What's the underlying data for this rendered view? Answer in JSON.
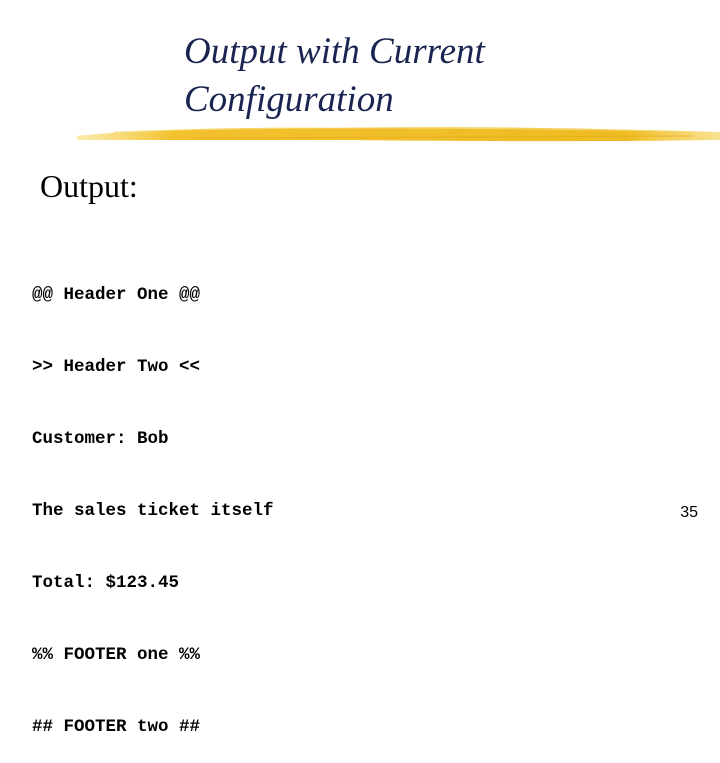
{
  "slide": {
    "title_lines": [
      "Output with Current",
      "Configuration"
    ],
    "section_label": "Output:",
    "output_lines": [
      "@@ Header One @@",
      ">> Header Two <<",
      "Customer: Bob",
      "The sales ticket itself",
      "Total: $123.45",
      "%% FOOTER one %%",
      "## FOOTER two ##"
    ],
    "page_number": "35",
    "colors": {
      "title": "#1a2450",
      "brush_stroke": "#f2c12e"
    }
  }
}
